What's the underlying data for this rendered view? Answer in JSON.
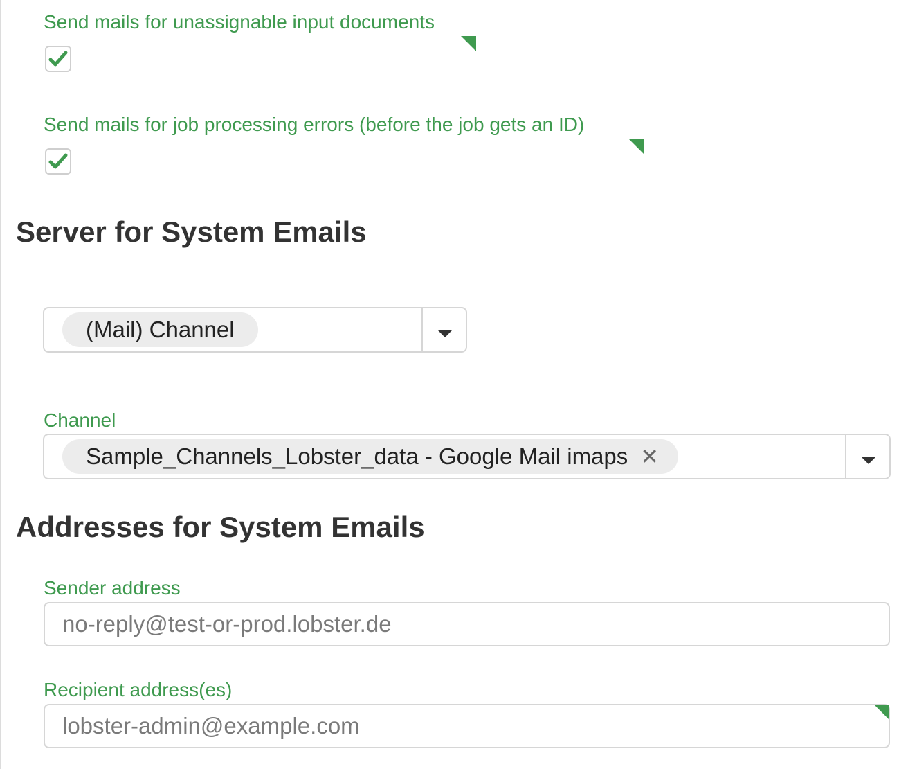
{
  "notifications": {
    "unassignable_label": "Send mails for unassignable input documents",
    "unassignable_checked": true,
    "job_errors_label": "Send mails for job processing errors (before the job gets an ID)",
    "job_errors_checked": true
  },
  "server_section": {
    "heading": "Server for System Emails",
    "type_select_value": "(Mail) Channel",
    "channel_label": "Channel",
    "channel_value": "Sample_Channels_Lobster_data - Google Mail imaps"
  },
  "addresses_section": {
    "heading": "Addresses for System Emails",
    "sender_label": "Sender address",
    "sender_placeholder": "no-reply@test-or-prod.lobster.de",
    "recipient_label": "Recipient address(es)",
    "recipient_placeholder": "lobster-admin@example.com"
  },
  "colors": {
    "accent_green": "#3f9a4f",
    "heading_text": "#333333",
    "border_gray": "#d6d6d6"
  }
}
